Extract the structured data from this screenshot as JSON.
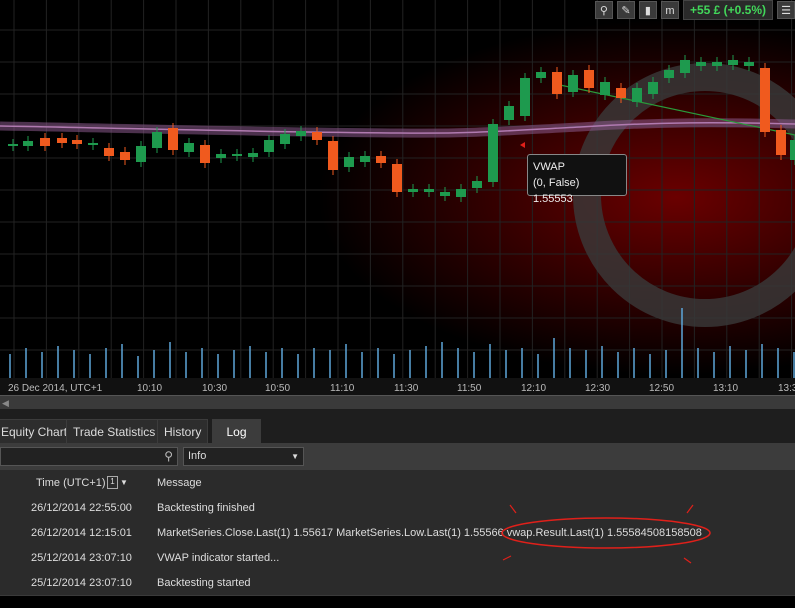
{
  "toolbar": {
    "pnl_label": "+55 £ (+0.5%)",
    "icons": [
      "zoom-icon",
      "chart-settings-icon",
      "candle-style-icon",
      "timeframe-icon",
      "list-icon"
    ]
  },
  "chart": {
    "tooltip": {
      "title": "VWAP",
      "value": "(0, False) 1.55553"
    },
    "time_axis": [
      "26 Dec 2014, UTC+1",
      "10:10",
      "10:30",
      "10:50",
      "11:10",
      "11:30",
      "11:50",
      "12:10",
      "12:30",
      "12:50",
      "13:10",
      "13:3"
    ],
    "colors": {
      "bull": "#1e9a4e",
      "bear": "#f05a1e",
      "vwap": "#8b5a8c",
      "trend": "#2a9a3a",
      "volume": "#5da5d8"
    }
  },
  "tabs": [
    {
      "label": "Equity Chart"
    },
    {
      "label": "Trade Statistics"
    },
    {
      "label": "History"
    },
    {
      "label": "Log",
      "active": true
    }
  ],
  "filter": {
    "search_value": "",
    "level": "Info"
  },
  "log": {
    "col_time": "Time (UTC+1)",
    "sort_badge": "1",
    "col_message": "Message",
    "rows": [
      {
        "time": "26/12/2014 22:55:00",
        "message": "Backtesting finished"
      },
      {
        "time": "26/12/2014 12:15:01",
        "message": "MarketSeries.Close.Last(1) 1.55617 MarketSeries.Low.Last(1) 1.55566 vwap.Result.Last(1) 1.55584508158508"
      },
      {
        "time": "25/12/2014 23:07:10",
        "message": "VWAP indicator started..."
      },
      {
        "time": "25/12/2014 23:07:10",
        "message": "Backtesting started"
      }
    ]
  }
}
